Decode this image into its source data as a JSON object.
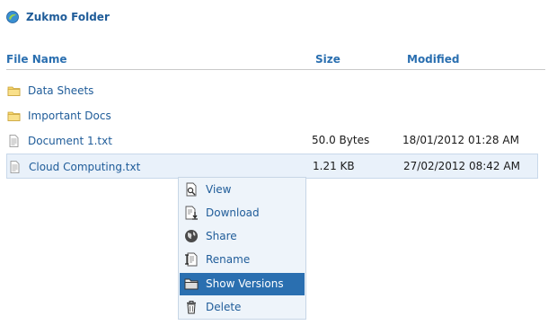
{
  "header": {
    "title": "Zukmo Folder"
  },
  "columns": {
    "name": "File Name",
    "size": "Size",
    "modified": "Modified"
  },
  "files": [
    {
      "name": "Data Sheets",
      "type": "folder",
      "size": "",
      "modified": ""
    },
    {
      "name": "Important Docs",
      "type": "folder",
      "size": "",
      "modified": ""
    },
    {
      "name": "Document 1.txt",
      "type": "file",
      "size": "50.0 Bytes",
      "modified": "18/01/2012 01:28 AM"
    },
    {
      "name": "Cloud Computing.txt",
      "type": "file",
      "size": "1.21 KB",
      "modified": "27/02/2012 08:42 AM",
      "selected": true
    }
  ],
  "context_menu": {
    "items": [
      {
        "label": "View",
        "icon": "view-icon"
      },
      {
        "label": "Download",
        "icon": "download-icon"
      },
      {
        "label": "Share",
        "icon": "globe-icon"
      },
      {
        "label": "Rename",
        "icon": "rename-icon"
      },
      {
        "label": "Show Versions",
        "icon": "folder-icon",
        "highlighted": true
      },
      {
        "label": "Delete",
        "icon": "trash-icon"
      }
    ]
  },
  "colors": {
    "accent": "#2a6fb0",
    "link": "#1f5c99",
    "selection": "#e9f1fa",
    "folder": "#f2c94c"
  }
}
